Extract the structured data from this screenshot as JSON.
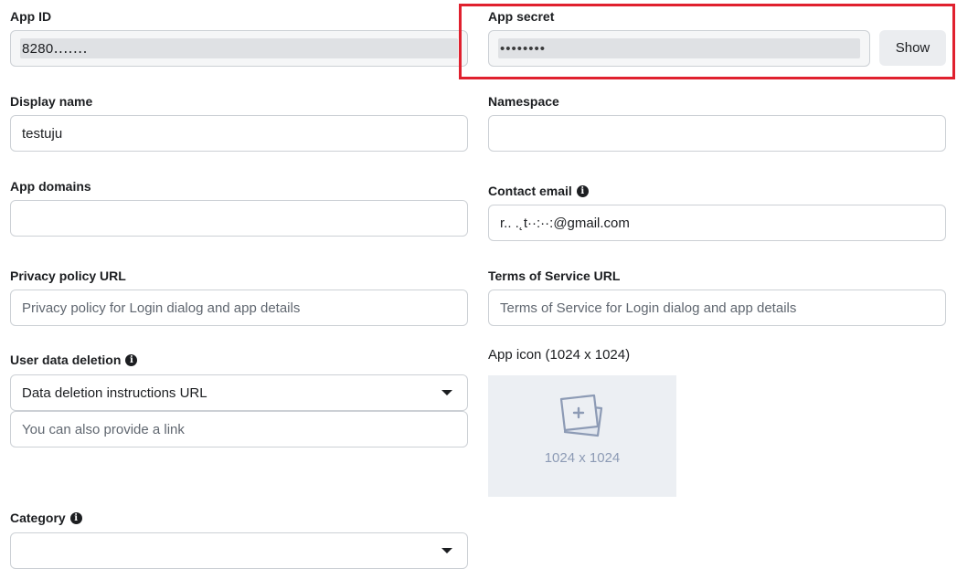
{
  "app_id": {
    "label": "App ID",
    "value": "8280․․․․․․․"
  },
  "app_secret": {
    "label": "App secret",
    "value": "••••••••",
    "show_label": "Show"
  },
  "display_name": {
    "label": "Display name",
    "value": "testuju"
  },
  "namespace": {
    "label": "Namespace",
    "value": ""
  },
  "app_domains": {
    "label": "App domains",
    "value": ""
  },
  "contact_email": {
    "label": "Contact email",
    "value": "r.. .˛t··:··:@gmail.com"
  },
  "privacy_policy": {
    "label": "Privacy policy URL",
    "placeholder": "Privacy policy for Login dialog and app details"
  },
  "terms_of_service": {
    "label": "Terms of Service URL",
    "placeholder": "Terms of Service for Login dialog and app details"
  },
  "user_data_deletion": {
    "label": "User data deletion",
    "selected": "Data deletion instructions URL",
    "link_placeholder": "You can also provide a link"
  },
  "app_icon": {
    "label": "App icon (1024 x 1024)",
    "size_text": "1024 x 1024"
  },
  "category": {
    "label": "Category",
    "selected": ""
  },
  "icons": {
    "info": "info-icon",
    "image": "image-add-icon",
    "dropdown": "caret-down-icon"
  },
  "colors": {
    "highlight": "#e0202e",
    "icon_tint": "#8d9bb5"
  }
}
